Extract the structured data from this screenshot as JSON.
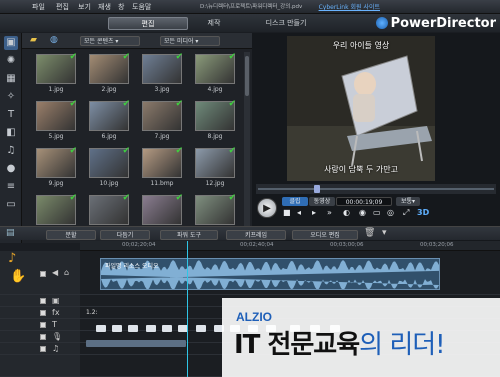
{
  "titlebar": {
    "menus": [
      "파일",
      "편집",
      "보기",
      "재생",
      "창",
      "도움말"
    ],
    "file_path": "D:\\뉴디렉터\\프로젝트\\파워디렉터_강의.pdv",
    "user_link": "CyberLink 회원 사이트"
  },
  "modes": [
    "편집",
    "제작",
    "디스크 만들기"
  ],
  "brand": {
    "name": "PowerDirector"
  },
  "library": {
    "filter1": "모든 콘텐츠",
    "filter2": "모든 미디어",
    "items": [
      {
        "name": "1.jpg"
      },
      {
        "name": "2.jpg"
      },
      {
        "name": "3.jpg"
      },
      {
        "name": "4.jpg"
      },
      {
        "name": "5.jpg"
      },
      {
        "name": "6.jpg"
      },
      {
        "name": "7.jpg"
      },
      {
        "name": "8.jpg"
      },
      {
        "name": "9.jpg"
      },
      {
        "name": "10.jpg"
      },
      {
        "name": "11.bmp"
      },
      {
        "name": "12.jpg"
      },
      {
        "name": ""
      },
      {
        "name": ""
      },
      {
        "name": ""
      },
      {
        "name": ""
      }
    ]
  },
  "preview": {
    "caption_top": "우리 아이들 영상",
    "caption_bottom": "사랑이 담뿍 두 가만고",
    "clip_label": "클립",
    "movie_label": "동영상",
    "timecode": "00:00:19;09",
    "quality": "보통",
    "mode_3d": "3D"
  },
  "timeline_tools": [
    "분할",
    "다듬기",
    "파워 도구",
    "키프레임",
    "오디오 편집"
  ],
  "ruler": [
    "00;02;20;04",
    "00;02;40;04",
    "00;03;00;06",
    "00;03;20;06"
  ],
  "tracks": {
    "audio_clip_name": "파일명 리소스 오디오",
    "track_label_1": "1.2:"
  },
  "banner": {
    "org": "ALZIO",
    "headline_main": "IT 전문교육",
    "headline_tail": "의 리더!"
  },
  "colors": {
    "accent": "#2fc6e6",
    "brand_blue": "#1e5fb8",
    "check_green": "#3ed03e"
  }
}
